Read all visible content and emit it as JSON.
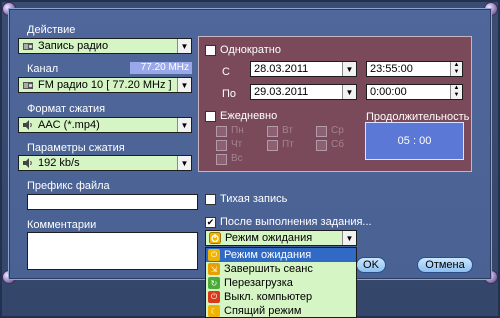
{
  "sections": {
    "action_label": "Действие",
    "action_value": "Запись радио",
    "channel_label": "Канал",
    "channel_freq": "77.20 MHz",
    "channel_value": "FM радио 10 [ 77.20 MHz ]",
    "format_label": "Формат сжатия",
    "format_value": "AAC (*.mp4)",
    "params_label": "Параметры сжатия",
    "params_value": "192 kb/s",
    "prefix_label": "Префикс файла",
    "prefix_value": "",
    "comments_label": "Комментарии",
    "comments_value": ""
  },
  "schedule": {
    "once_label": "Однократно",
    "from_label": "С",
    "to_label": "По",
    "from_date": "28.03.2011",
    "from_time": "23:55:00",
    "to_date": "29.03.2011",
    "to_time": "0:00:00",
    "daily_label": "Ежедневно",
    "days": [
      "Пн",
      "Вт",
      "Ср",
      "Чт",
      "Пт",
      "Сб",
      "Вс"
    ],
    "duration_label": "Продолжительность",
    "duration_value": "05 : 00"
  },
  "options": {
    "quiet_label": "Тихая запись",
    "after_label": "После выполнения задания...",
    "after_value": "Режим ожидания",
    "after_checked": "✔"
  },
  "dropdown": {
    "items": [
      {
        "label": "Режим ожидания",
        "icon": "standby-icon",
        "color": "#f0b400"
      },
      {
        "label": "Завершить сеанс",
        "icon": "logoff-icon",
        "color": "#e8a000"
      },
      {
        "label": "Перезагрузка",
        "icon": "restart-icon",
        "color": "#4caa3a"
      },
      {
        "label": "Выкл. компьютер",
        "icon": "power-icon",
        "color": "#d83a1a"
      },
      {
        "label": "Спящий режим",
        "icon": "sleep-icon",
        "color": "#f0b400"
      }
    ]
  },
  "buttons": {
    "ok": "OK",
    "cancel": "Отмена"
  }
}
